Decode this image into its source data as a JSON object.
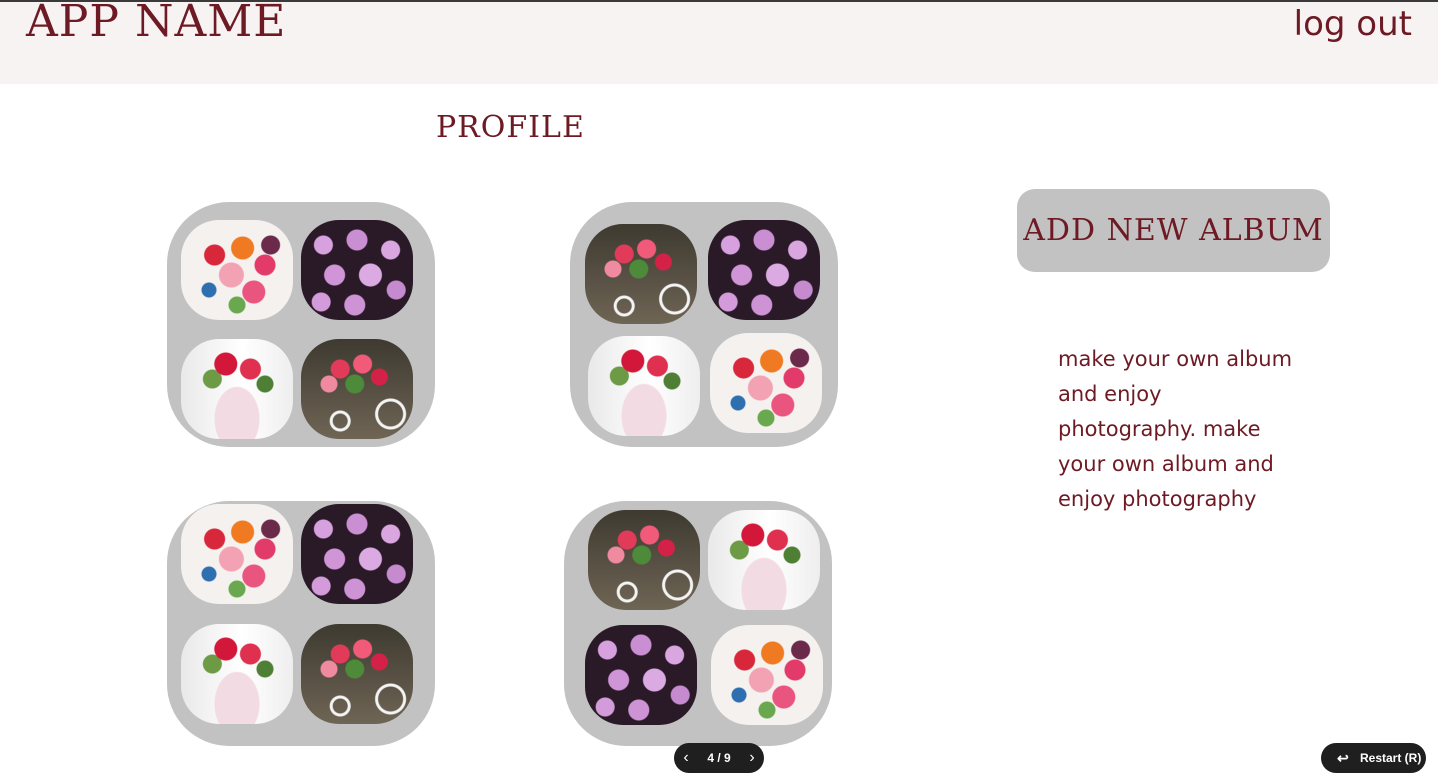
{
  "header": {
    "app_name": "APP NAME",
    "logout_label": "log out"
  },
  "main": {
    "title": "PROFILE",
    "albums": [
      {
        "thumbnails": [
          "roses-bouquet",
          "pink-phlox-flowers",
          "roses-in-vase",
          "flower-bicycle-basket"
        ]
      },
      {
        "thumbnails": [
          "flower-bicycle-basket",
          "pink-phlox-flowers",
          "roses-in-vase",
          "roses-bouquet"
        ]
      },
      {
        "thumbnails": [
          "roses-bouquet",
          "pink-phlox-flowers",
          "roses-in-vase",
          "flower-bicycle-basket"
        ]
      },
      {
        "thumbnails": [
          "flower-bicycle-basket",
          "roses-in-vase",
          "pink-phlox-flowers",
          "roses-bouquet"
        ]
      }
    ]
  },
  "sidebar": {
    "add_album_label": "ADD NEW ALBUM",
    "blurb": "make your own album and enjoy photography. make your own album and enjoy photography"
  },
  "pager": {
    "prev_icon": "chevron-left-icon",
    "count": "4 / 9",
    "next_icon": "chevron-right-icon"
  },
  "restart": {
    "icon": "return-arrow-icon",
    "label": "Restart (R)"
  },
  "colors": {
    "accent_text": "#6e1a24",
    "header_bg": "#f8f3f3",
    "card_bg": "#c2c2c2",
    "control_bg": "#1f1f1f"
  }
}
